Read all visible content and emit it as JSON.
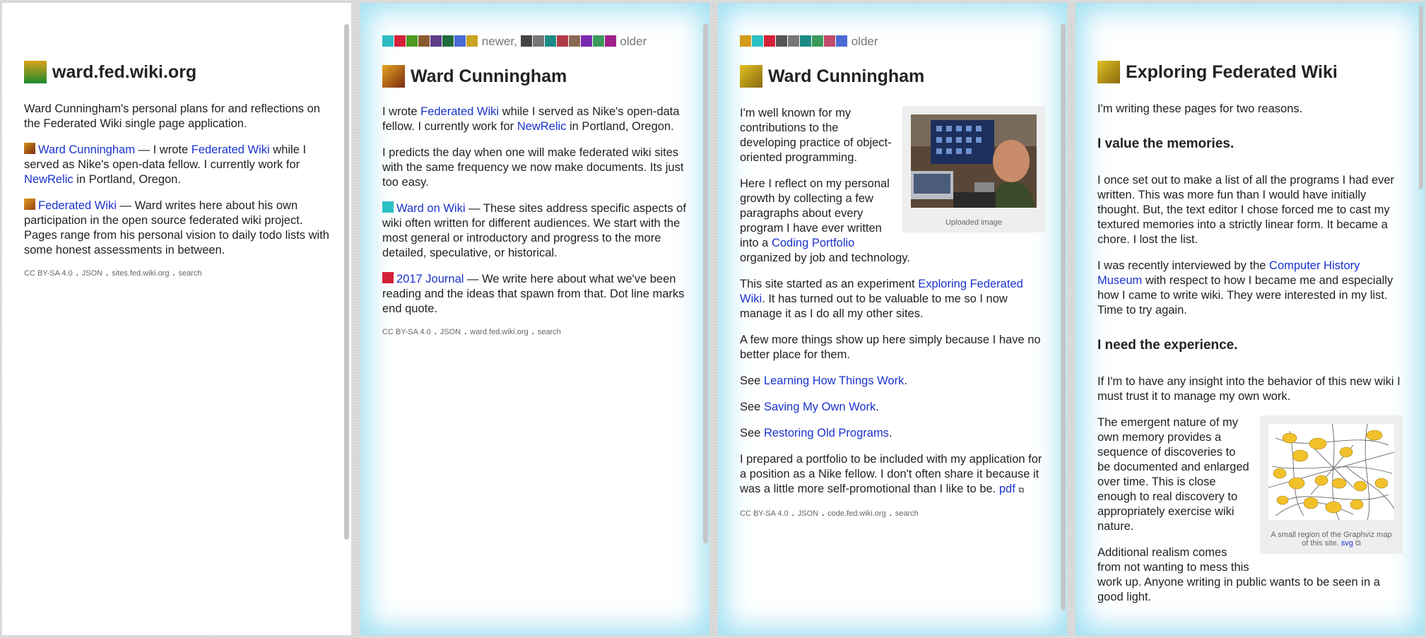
{
  "pages": [
    {
      "title": "ward.fed.wiki.org",
      "paragraphs": [
        "Ward Cunningham's personal plans for and reflections on the Federated Wiki single page application."
      ],
      "references": [
        {
          "link": "Ward Cunningham",
          "text": " — I wrote ",
          "link2": "Federated Wiki",
          "text2": " while I served as Nike's open-data fellow. I currently work for ",
          "link3": "NewRelic",
          "text3": " in Portland, Oregon."
        },
        {
          "link": "Federated Wiki",
          "text": " — Ward writes here about his own participation in the open source federated wiki project. Pages range from his personal vision to daily todo lists with some honest assessments in between."
        }
      ],
      "footer": {
        "license": "CC BY-SA 4.0",
        "json": "JSON",
        "site": "sites.fed.wiki.org",
        "search": "search"
      }
    },
    {
      "twins": {
        "newer": "newer,",
        "older": "older"
      },
      "title": "Ward Cunningham",
      "p1": {
        "a": "I wrote ",
        "link": "Federated Wiki",
        "b": " while I served as Nike's open-data fellow. I currently work for ",
        "link2": "NewRelic",
        "c": " in Portland, Oregon."
      },
      "p2": "I predicts the day when one will make federated wiki sites with the same frequency we now make documents. Its just too easy.",
      "ref1": {
        "link": "Ward on Wiki",
        "text": " — These sites address specific aspects of wiki often written for different audiences. We start with the most general or introductory and progress to the more detailed, speculative, or historical."
      },
      "ref2": {
        "link": "2017 Journal",
        "text": " — We write here about what we've been reading and the ideas that spawn from that. Dot line marks end quote."
      },
      "footer": {
        "license": "CC BY-SA 4.0",
        "json": "JSON",
        "site": "ward.fed.wiki.org",
        "search": "search"
      }
    },
    {
      "twins": {
        "older": "older"
      },
      "title": "Ward Cunningham",
      "image_caption": "Uploaded image",
      "p1": "I'm well known for my contributions to the developing practice of object-oriented programming.",
      "p2": {
        "a": "Here I reflect on my personal growth by collecting a few paragraphs about every program I have ever written into a ",
        "link": "Coding Portfolio",
        "b": " organized by job and technology."
      },
      "p3": {
        "a": "This site started as an experiment ",
        "link": "Exploring Federated Wiki",
        "b": ". It has turned out to be valuable to me so I now manage it as I do all my other sites."
      },
      "p4": "A few more things show up here simply because I have no better place for them.",
      "see1": {
        "a": "See ",
        "link": "Learning How Things Work",
        "b": "."
      },
      "see2": {
        "a": "See ",
        "link": "Saving My Own Work",
        "b": "."
      },
      "see3": {
        "a": "See ",
        "link": "Restoring Old Programs",
        "b": "."
      },
      "p5": {
        "a": "I prepared a portfolio to be included with my application for a position as a Nike fellow. I don't often share it because it was a little more self-promotional than I like to be. ",
        "link": "pdf"
      },
      "footer": {
        "license": "CC BY-SA 4.0",
        "json": "JSON",
        "site": "code.fed.wiki.org",
        "search": "search"
      }
    },
    {
      "title": "Exploring Federated Wiki",
      "p1": "I'm writing these pages for two reasons.",
      "h1": "I value the memories.",
      "p2": "I once set out to make a list of all the programs I had ever written. This was more fun than I would have initially thought. But, the text editor I chose forced me to cast my textured memories into a strictly linear form. It became a chore. I lost the list.",
      "p3": {
        "a": "I was recently interviewed by the ",
        "link": "Computer History Museum",
        "b": " with respect to how I became me and especially how I came to write wiki. They were interested in my list. Time to try again."
      },
      "h2": "I need the experience.",
      "p4": "If I'm to have any insight into the behavior of this new wiki I must trust it to manage my own work.",
      "image_caption": "A small region of the Graphviz map of this site.",
      "image_link": "svg",
      "p5": "The emergent nature of my own memory provides a sequence of discoveries to be documented and enlarged over time. This is close enough to real discovery to appropriately exercise wiki nature.",
      "p6": "Additional realism comes from not wanting to mess this work up. Anyone writing in public wants to be seen in a good light."
    }
  ],
  "colors": {
    "link": "#1a33cc",
    "glow": "#7dd4ee"
  },
  "icons": [
    "favicon-square",
    "external-link-icon"
  ]
}
